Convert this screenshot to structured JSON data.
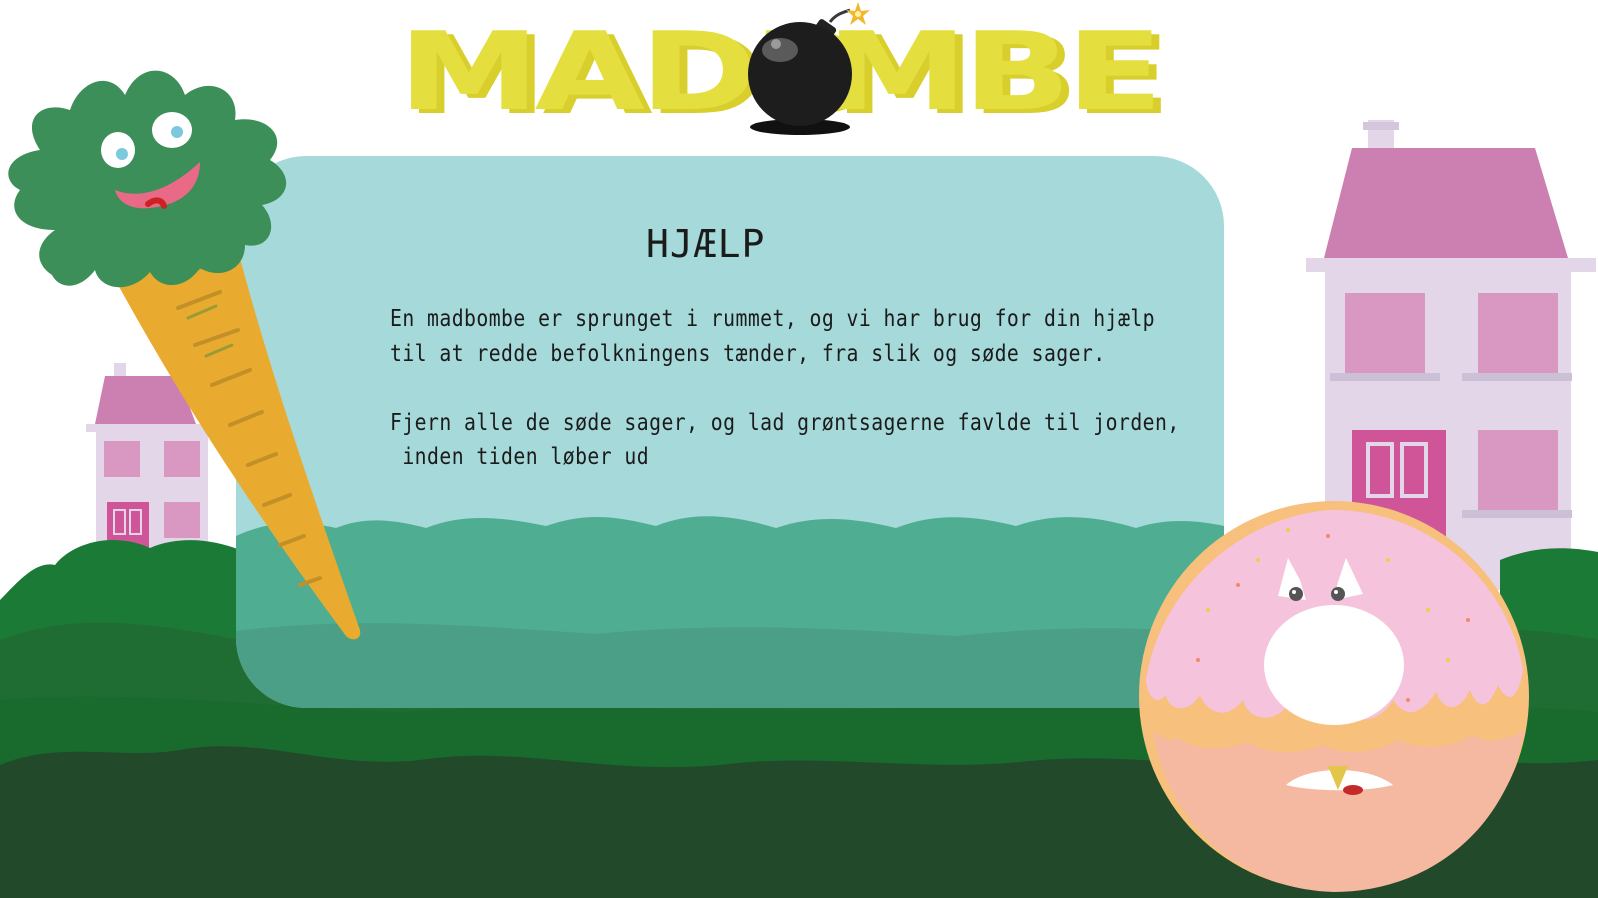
{
  "logo": {
    "part1": "MADB",
    "part2": "MBE"
  },
  "help": {
    "title": "HJÆLP",
    "lines": [
      "En madbombe er sprunget i rummet, og vi har brug for din hjælp",
      "til at redde befolkningens tænder, fra slik og søde sager.",
      "Fjern alle de søde sager, og lad grøntsagerne favlde til jorden,",
      " inden tiden løber ud"
    ]
  },
  "colors": {
    "logo_yellow": "#e4df3f",
    "panel": "#a6d9d9",
    "house_roof": "#cc80b2",
    "house_wall": "#e2d6e8",
    "door": "#d05598",
    "grass_light": "#1b7a36",
    "grass_dark": "#22492a",
    "carrot": "#e8ab2f",
    "carrot_leaves": "#3d8f5a",
    "donut_dough": "#f7c07c",
    "donut_icing": "#f5c3dc"
  },
  "icons": {
    "bomb": "bomb-icon",
    "carrot": "carrot-character",
    "donut": "donut-character"
  }
}
